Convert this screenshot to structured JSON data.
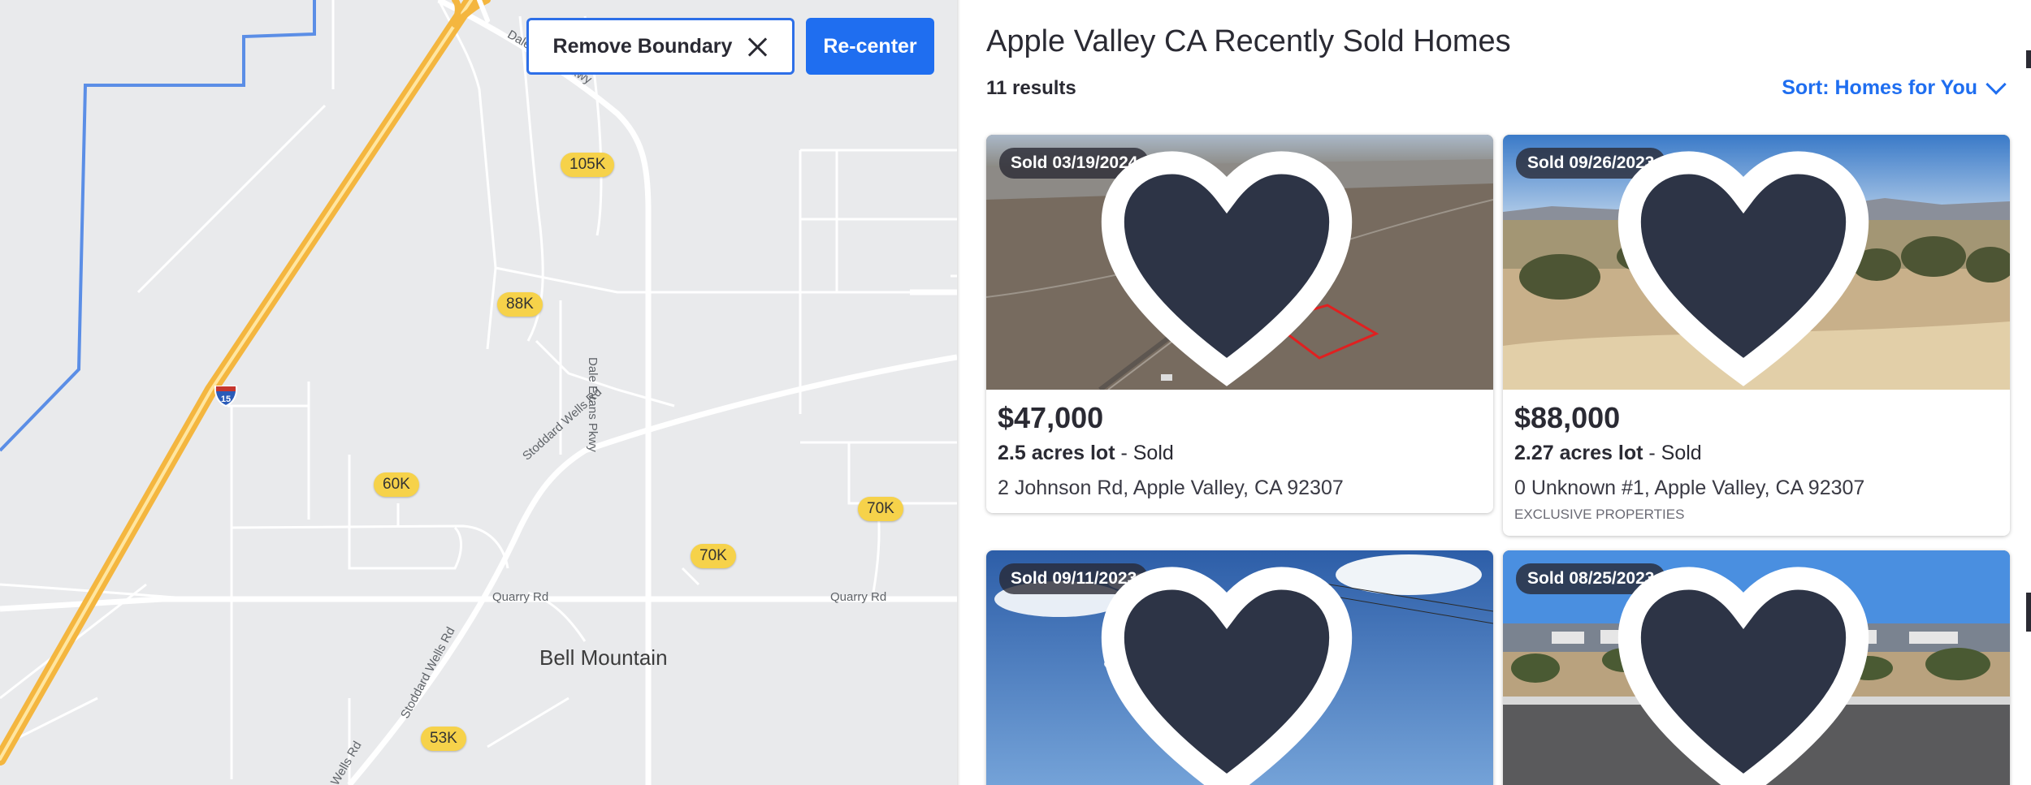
{
  "map": {
    "remove_boundary_label": "Remove Boundary",
    "recenter_label": "Re-center",
    "interstate": "15",
    "place": "Bell Mountain",
    "roads": {
      "dale_evans_top": "Dale Evans Pkwy",
      "dale_evans_vertical": "Dale Evans Pkwy",
      "stoddard_upper": "Stoddard Wells Rd",
      "stoddard_lower": "Stoddard Wells Rd",
      "quarry_left": "Quarry Rd",
      "quarry_right": "Quarry Rd",
      "bottom_partial": "Wells Rd"
    },
    "pins": [
      {
        "label": "105K"
      },
      {
        "label": "88K"
      },
      {
        "label": "60K"
      },
      {
        "label": "70K"
      },
      {
        "label": "70K"
      },
      {
        "label": "53K"
      }
    ]
  },
  "list": {
    "title": "Apple Valley CA Recently Sold Homes",
    "results": "11 results",
    "sort_label": "Sort: Homes for You",
    "cards": [
      {
        "badge": "Sold 03/19/2024",
        "price": "$47,000",
        "lot": "2.5 acres lot",
        "status": " - Sold",
        "address": "2 Johnson Rd, Apple Valley, CA 92307",
        "broker": ""
      },
      {
        "badge": "Sold 09/26/2023",
        "price": "$88,000",
        "lot": "2.27 acres lot",
        "status": " - Sold",
        "address": "0 Unknown #1, Apple Valley, CA 92307",
        "broker": "EXCLUSIVE PROPERTIES"
      },
      {
        "badge": "Sold 09/11/2023"
      },
      {
        "badge": "Sold 08/25/2023"
      }
    ]
  },
  "colors": {
    "accent": "#1f6ef0",
    "pin": "#f6d24a",
    "freeway": "#f4b63f",
    "boundary": "#5b8ee6"
  }
}
